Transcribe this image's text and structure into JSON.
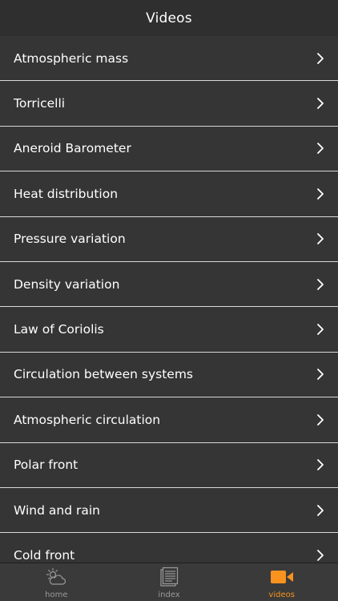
{
  "header": {
    "title": "Videos"
  },
  "videos": [
    {
      "label": "Atmospheric mass"
    },
    {
      "label": "Torricelli"
    },
    {
      "label": "Aneroid Barometer"
    },
    {
      "label": "Heat distribution"
    },
    {
      "label": "Pressure variation"
    },
    {
      "label": "Density variation"
    },
    {
      "label": "Law of Coriolis"
    },
    {
      "label": "Circulation between systems"
    },
    {
      "label": "Atmospheric circulation"
    },
    {
      "label": "Polar front"
    },
    {
      "label": "Wind and rain"
    },
    {
      "label": "Cold front"
    }
  ],
  "tabs": [
    {
      "label": "home",
      "icon": "weather-icon",
      "active": false
    },
    {
      "label": "index",
      "icon": "document-icon",
      "active": false
    },
    {
      "label": "videos",
      "icon": "video-camera-icon",
      "active": true
    }
  ],
  "colors": {
    "accent": "#f7931e",
    "background": "#353535",
    "separator": "#d8d8d8",
    "text": "#ffffff",
    "tab_inactive": "#9a9a9a"
  }
}
